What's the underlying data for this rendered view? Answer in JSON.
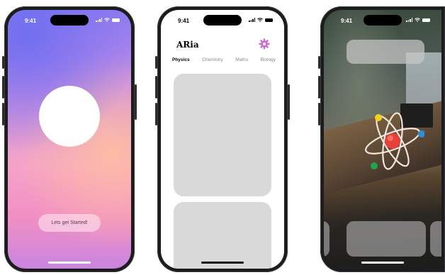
{
  "status_bar": {
    "time": "9:41"
  },
  "screens": {
    "onboarding": {
      "cta_label": "Lets get Started!"
    },
    "home": {
      "app_title": "ARia",
      "tabs": [
        "Physics",
        "Chemistry",
        "Maths",
        "Biology"
      ],
      "active_tab": "Physics"
    },
    "ar_view": {
      "model": "atom-icon"
    }
  },
  "colors": {
    "accent": "#c96fd0",
    "card": "#d9d9d9",
    "electron_yellow": "#f2d21b",
    "electron_blue": "#2e8fd6",
    "electron_green": "#1fa64a",
    "nucleus": "#e8413a"
  }
}
